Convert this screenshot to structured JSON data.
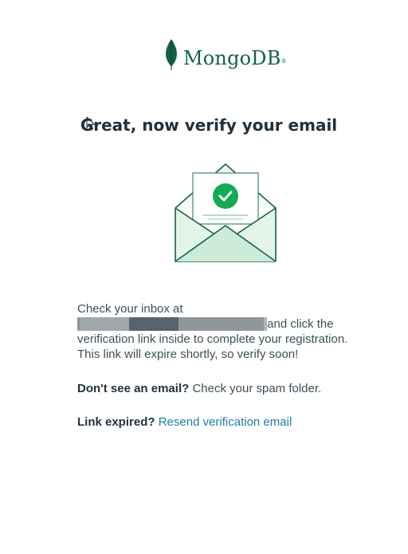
{
  "brand": {
    "name": "MongoDB",
    "registered_mark": "®",
    "leaf_icon": "mongodb-leaf-icon",
    "color": "#116149"
  },
  "headline": "Great, now verify your email",
  "illustration": {
    "icon": "envelope-check-icon",
    "accent": "#13aa52"
  },
  "instructions": {
    "prefix": "Check your inbox at",
    "email_redacted": "",
    "suffix_1": "and click the verification link inside to complete your registration. This link will expire shortly, so verify soon!"
  },
  "spam": {
    "question": "Don't see an email?",
    "answer": "Check your spam folder."
  },
  "expired": {
    "question": "Link expired?",
    "link_label": "Resend verification email"
  },
  "colors": {
    "text": "#3d4f58",
    "heading": "#21313c",
    "link": "#1a7faa"
  }
}
